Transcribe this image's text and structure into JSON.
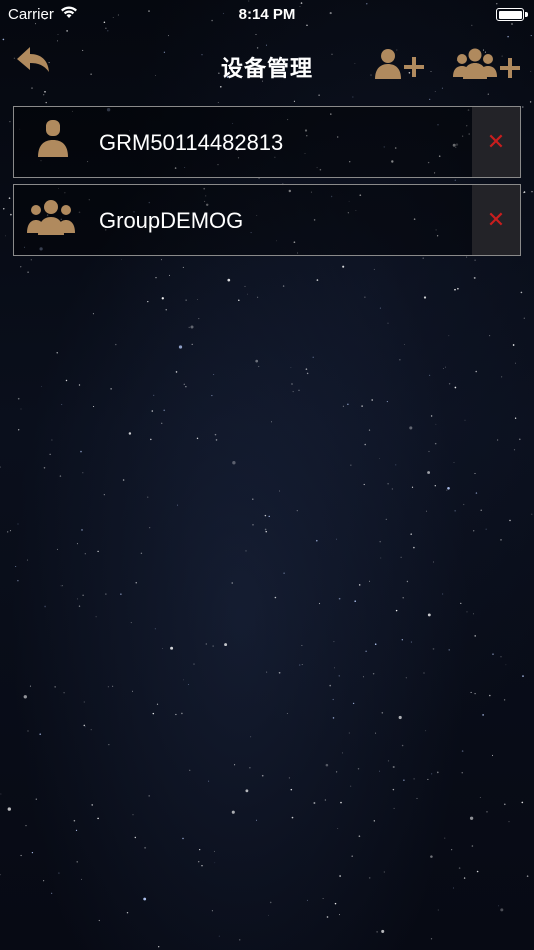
{
  "status_bar": {
    "carrier": "Carrier",
    "time": "8:14 PM",
    "battery_level": 1.0
  },
  "nav": {
    "title": "设备管理",
    "back_icon": "back-arrow-icon",
    "add_user_icon": "add-user-icon",
    "add_group_icon": "add-group-icon"
  },
  "devices": [
    {
      "name": "GRM50114482813",
      "type": "single",
      "icon": "person-icon",
      "delete_symbol": "✕"
    },
    {
      "name": "GroupDEMOG",
      "type": "group",
      "icon": "group-icon",
      "delete_symbol": "✕"
    }
  ],
  "colors": {
    "icon_accent": "#b08a5e",
    "delete_red": "#c81e1e",
    "row_border": "#8a8a8a",
    "background": "#05080f"
  }
}
